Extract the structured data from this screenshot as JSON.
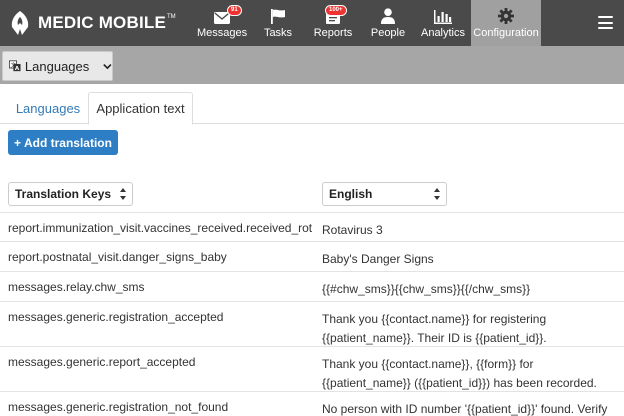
{
  "app": {
    "brand": "MEDIC MOBILE",
    "trademark": "TM"
  },
  "nav": {
    "items": [
      {
        "label": "Messages",
        "icon": "envelope-icon",
        "badge": "91"
      },
      {
        "label": "Tasks",
        "icon": "flag-icon",
        "badge": ""
      },
      {
        "label": "Reports",
        "icon": "reports-icon",
        "badge": "100+"
      },
      {
        "label": "People",
        "icon": "person-icon",
        "badge": ""
      },
      {
        "label": "Analytics",
        "icon": "bar-chart-icon",
        "badge": ""
      },
      {
        "label": "Configuration",
        "icon": "gear-icon",
        "badge": ""
      }
    ],
    "active": "Configuration"
  },
  "subheader": {
    "dropdown_label": "Languages"
  },
  "tabs": [
    {
      "label": "Languages",
      "active": false
    },
    {
      "label": "Application text",
      "active": true
    }
  ],
  "add_button": {
    "label": "+ Add translation"
  },
  "columns": {
    "keys": "Translation Keys",
    "language": "English"
  },
  "rows": [
    {
      "key": "report.immunization_visit.vaccines_received.received_rotavirus",
      "value_lines": [
        "Rotavirus 3"
      ]
    },
    {
      "key": "report.postnatal_visit.danger_signs_baby",
      "value_lines": [
        "Baby's Danger Signs"
      ]
    },
    {
      "key": "messages.relay.chw_sms",
      "value_lines": [
        "{{#chw_sms}}{{chw_sms}}{{/chw_sms}}"
      ]
    },
    {
      "key": "messages.generic.registration_accepted",
      "value_lines": [
        "Thank you {{contact.name}} for registering",
        "{{patient_name}}. Their ID is {{patient_id}}."
      ]
    },
    {
      "key": "messages.generic.report_accepted",
      "value_lines": [
        "Thank you {{contact.name}}, {{form}} for",
        "{{patient_name}} ({{patient_id}}) has been recorded."
      ]
    },
    {
      "key": "messages.generic.registration_not_found",
      "value_lines": [
        "No person with ID number '{{patient_id}}' found. Verify"
      ]
    }
  ],
  "colors": {
    "header_bg": "#4a4a4a",
    "active_tab_bg": "#a0a0a0",
    "subbar_bg": "#a6a6a6",
    "primary_button": "#2d7ec5",
    "badge": "#e33333",
    "link": "#337ab7"
  }
}
